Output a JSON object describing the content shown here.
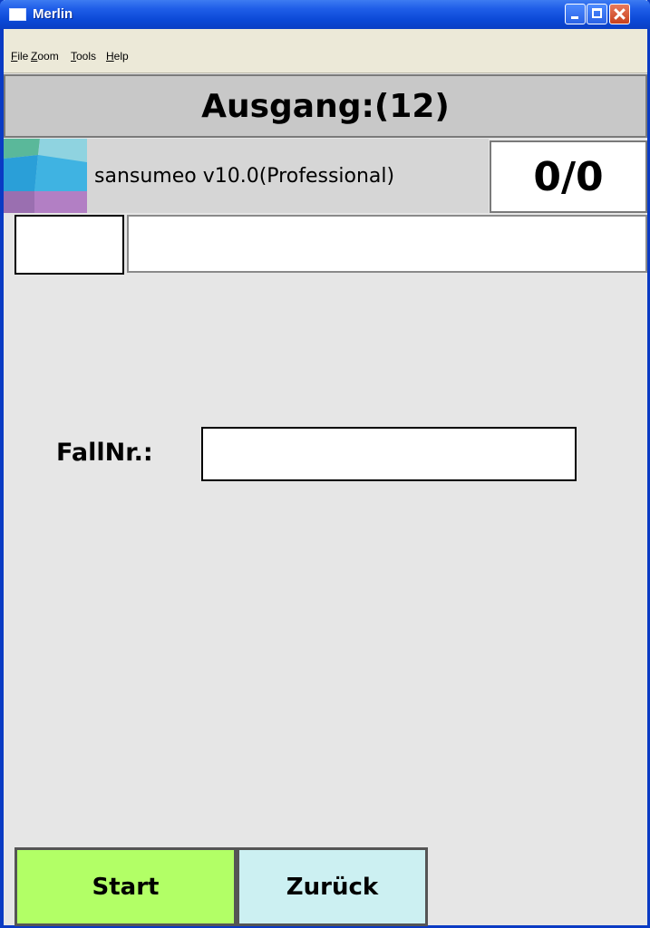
{
  "window": {
    "title": "Merlin"
  },
  "menu": {
    "items": [
      {
        "label": "File",
        "accel": "F",
        "rest": "ile"
      },
      {
        "label": "Zoom",
        "accel": "Z",
        "rest": "oom"
      },
      {
        "label": "Tools",
        "accel": "T",
        "rest": "ools"
      },
      {
        "label": "Help",
        "accel": "H",
        "rest": "elp"
      }
    ]
  },
  "header": {
    "title": "Ausgang:(12)"
  },
  "app": {
    "version": "sansumeo v10.0(Professional)",
    "counter": "0/0"
  },
  "form": {
    "fallnr_label": "FallNr.:",
    "fallnr_value": ""
  },
  "buttons": {
    "start": "Start",
    "back": "Zurück"
  },
  "colors": {
    "start_button": "#b2ff66",
    "back_button": "#ccf0f2",
    "titlebar": "#0b48d6",
    "background": "#e6e6e6"
  }
}
